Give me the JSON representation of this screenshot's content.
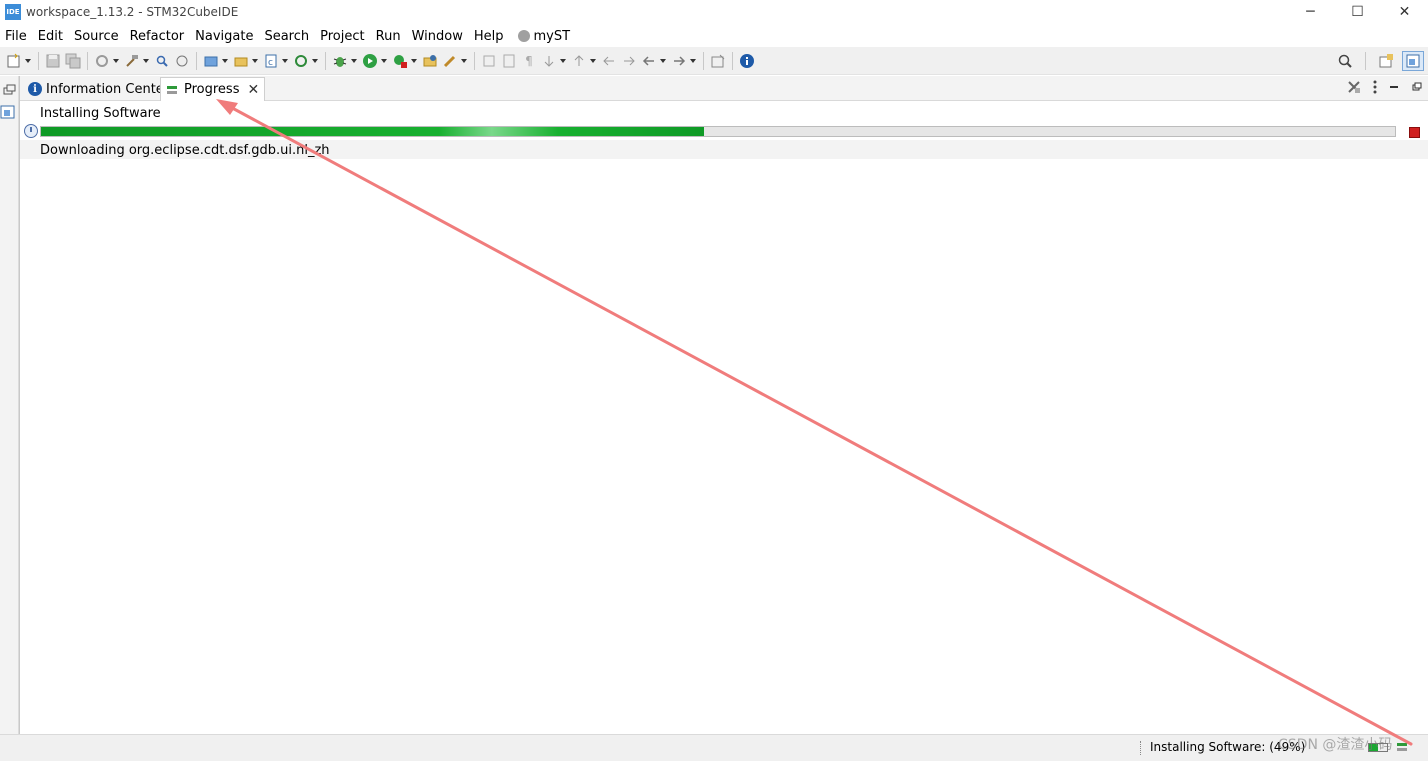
{
  "window": {
    "app_badge": "IDE",
    "title": "workspace_1.13.2 - STM32CubeIDE",
    "min_glyph": "─",
    "max_glyph": "☐",
    "close_glyph": "✕"
  },
  "menu": [
    "File",
    "Edit",
    "Source",
    "Refactor",
    "Navigate",
    "Search",
    "Project",
    "Run",
    "Window",
    "Help"
  ],
  "menu_user": "myST",
  "toolbar_icons": [
    "new-icon",
    "save-icon",
    "save-all-icon",
    "build-config-icon",
    "build-icon",
    "search-icon",
    "debug-icon",
    "run-icon",
    "external-tools-icon",
    "info-icon"
  ],
  "tabs": {
    "info_label": "Information Center",
    "info_glyph": "i",
    "progress_label": "Progress",
    "close_glyph": "✕"
  },
  "job": {
    "name": "Installing Software",
    "detail": "Downloading org.eclipse.cdt.dsf.gdb.ui.nl_zh",
    "progress_fraction": 0.49
  },
  "status": {
    "text": "Installing Software: (49%)"
  },
  "watermark": "CSDN @渣渣小码",
  "colors": {
    "progress_green": "#18b030",
    "annotation_arrow": "#f07c7c",
    "cancel_red": "#d02020"
  }
}
